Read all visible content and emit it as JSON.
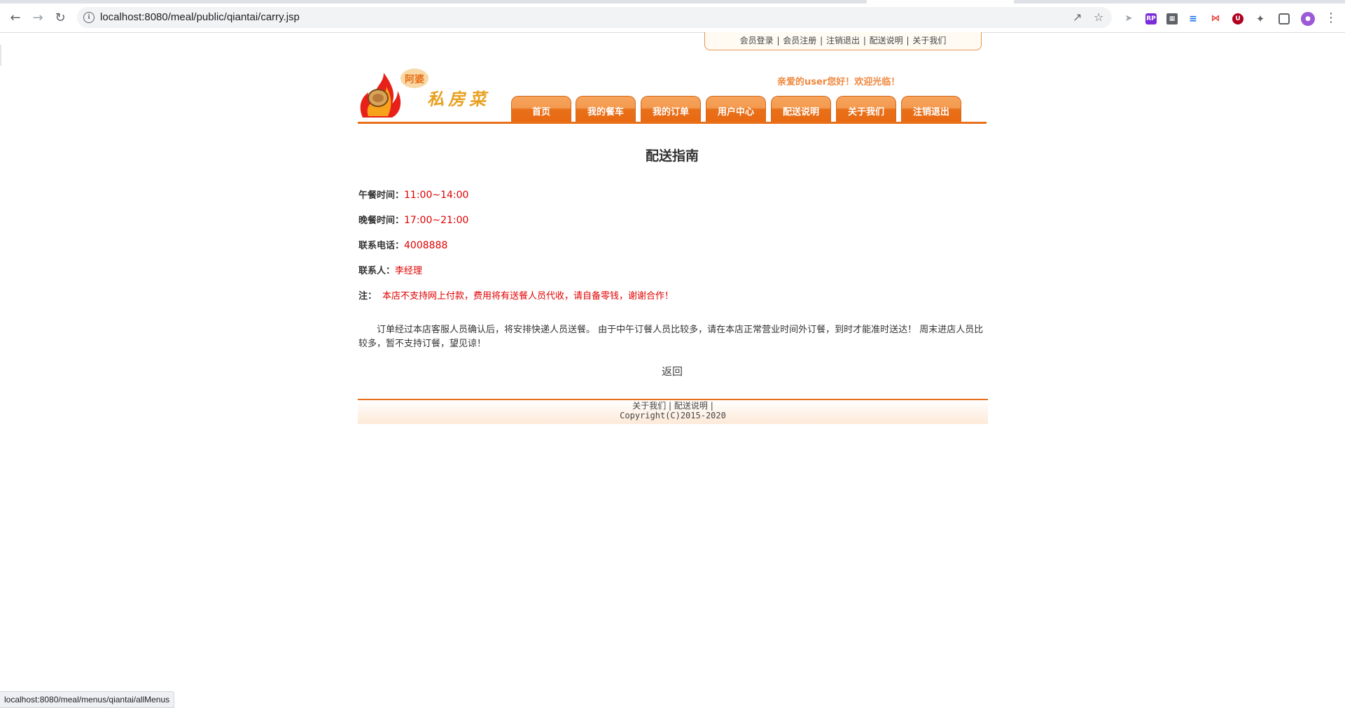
{
  "browser": {
    "url": "localhost:8080/meal/public/qiantai/carry.jsp",
    "status_url": "localhost:8080/meal/menus/qiantai/allMenus",
    "icons": [
      "back-arrow-icon",
      "forward-arrow-icon",
      "reload-icon",
      "info-icon",
      "share-icon",
      "star-icon",
      "extension-icon",
      "puzzle-icon",
      "sidepanel-icon",
      "profile-icon",
      "menu-dots-icon"
    ]
  },
  "top_links": [
    "会员登录",
    "会员注册",
    "注销退出",
    "配送说明",
    "关于我们"
  ],
  "logo": {
    "badge": "阿婆",
    "name": "私房菜"
  },
  "welcome": "亲爱的user您好！欢迎光临！",
  "nav": [
    "首页",
    "我的餐车",
    "我的订单",
    "用户中心",
    "配送说明",
    "关于我们",
    "注销退出"
  ],
  "main": {
    "title": "配送指南",
    "lunch_label": "午餐时间：",
    "lunch_value": "11:00~14:00",
    "dinner_label": "晚餐时间：",
    "dinner_value": "17:00~21:00",
    "phone_label": "联系电话：",
    "phone_value": "4008888",
    "contact_label": "联系人：",
    "contact_value": "李经理",
    "note_label": "注：",
    "note_value": "本店不支持网上付款，费用将有送餐人员代收，请自备零钱，谢谢合作！",
    "paragraph": "订单经过本店客服人员确认后，将安排快递人员送餐。 由于中午订餐人员比较多，请在本店正常营业时间外订餐，到时才能准时送达！ 周末进店人员比较多，暂不支持订餐，望见谅！",
    "back": "返回"
  },
  "footer": {
    "links": [
      "关于我们",
      "配送说明"
    ],
    "copyright": "Copyright(C)2015-2020"
  },
  "colors": {
    "accent": "#e8701a",
    "tab_light": "#f7a45d",
    "welcome": "#f0883e",
    "highlight": "#e00000"
  }
}
